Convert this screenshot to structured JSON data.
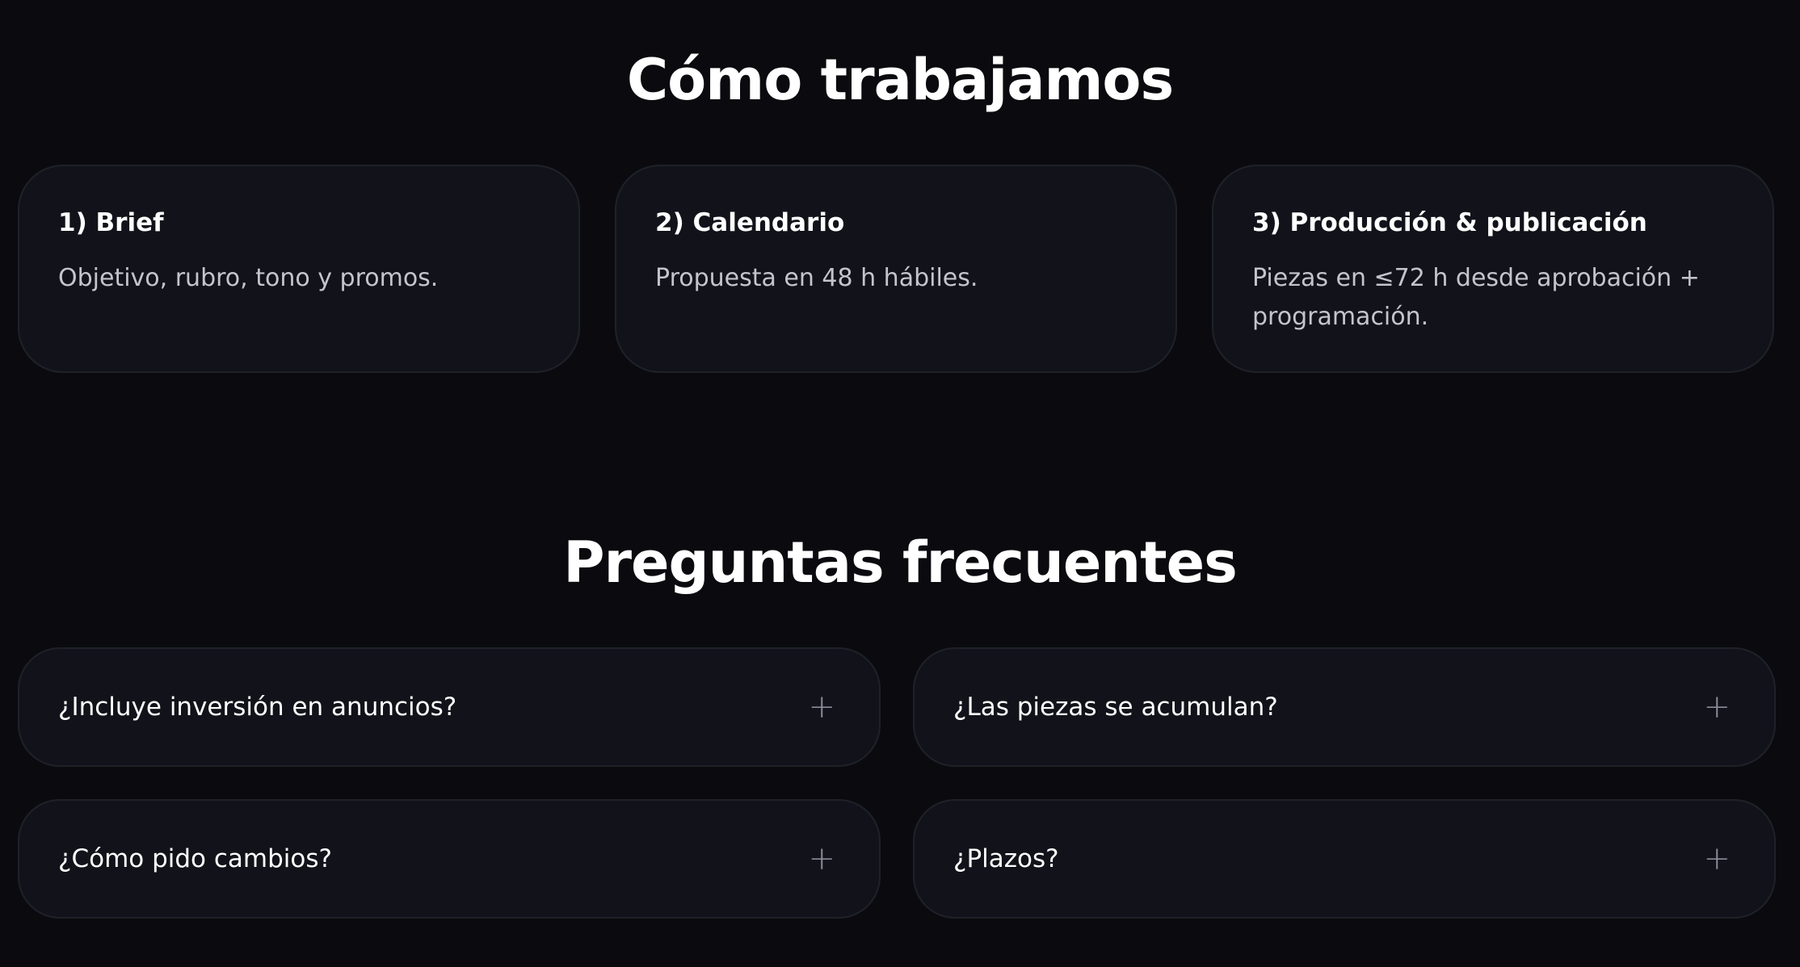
{
  "how": {
    "title": "Cómo trabajamos",
    "steps": [
      {
        "title": "1) Brief",
        "text": "Objetivo, rubro, tono y promos."
      },
      {
        "title": "2) Calendario",
        "text": "Propuesta en 48 h hábiles."
      },
      {
        "title": "3) Producción & publicación",
        "text": "Piezas en ≤72 h desde aprobación + programación."
      }
    ]
  },
  "faq": {
    "title": "Preguntas frecuentes",
    "items": [
      {
        "question": "¿Incluye inversión en anuncios?",
        "icon": "+"
      },
      {
        "question": "¿Las piezas se acumulan?",
        "icon": "+"
      },
      {
        "question": "¿Cómo pido cambios?",
        "icon": "+"
      },
      {
        "question": "¿Plazos?",
        "icon": "+"
      }
    ]
  }
}
